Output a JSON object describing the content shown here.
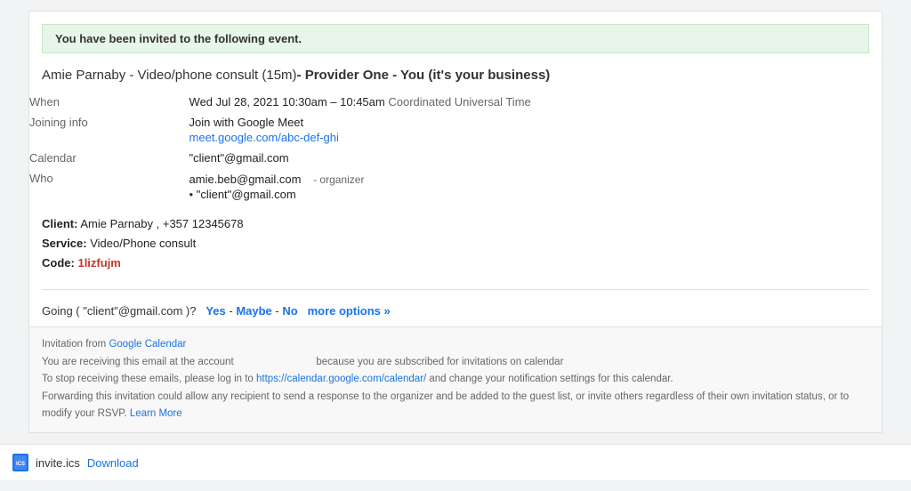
{
  "banner": {
    "text": "You have been invited to the following event."
  },
  "event": {
    "title_normal": "Amie Parnaby - Video/phone consult (15m)",
    "title_bold": "- Provider One - You (it's your business)",
    "when_label": "When",
    "when_value": "Wed Jul 28, 2021 10:30am – 10:45am",
    "when_timezone": "Coordinated Universal Time",
    "joining_label": "Joining info",
    "joining_text": "Join with Google Meet",
    "joining_link": "meet.google.com/abc-def-ghi",
    "calendar_label": "Calendar",
    "calendar_value": "\"client\"@gmail.com",
    "who_label": "Who",
    "who_organizer": "amie.beb@gmail.com",
    "who_organizer_tag": "- organizer",
    "who_attendee": "\"client\"@gmail.com",
    "client_label": "Client:",
    "client_name": "Amie Parnaby",
    "client_phone": ", +357 12345678",
    "service_label": "Service:",
    "service_value": "Video/Phone consult",
    "code_label": "Code:",
    "code_value": "1lizfujm",
    "going_prefix": "Going (",
    "going_account": "\"client\"@gmail.com",
    "going_suffix": ")?",
    "going_yes": "Yes",
    "going_dash1": "-",
    "going_maybe": "Maybe",
    "going_dash2": "-",
    "going_no": "No",
    "going_more": "more options »"
  },
  "footer": {
    "invitation_prefix": "Invitation from",
    "google_calendar_link": "Google Calendar",
    "line1": "You are receiving this email at the account",
    "line1_suffix": "because you are subscribed for invitations on calendar",
    "line2_prefix": "To stop receiving these emails, please log in to",
    "line2_link": "https://calendar.google.com/calendar/",
    "line2_suffix": "and change your notification settings for this calendar.",
    "line3": "Forwarding this invitation could allow any recipient to send a response to the organizer and be added to the guest list, or invite others regardless of their own invitation status, or to modify your RSVP.",
    "learn_more": "Learn More"
  },
  "attachment": {
    "icon_text": "📅",
    "filename": "invite.ics",
    "download_label": "Download"
  }
}
